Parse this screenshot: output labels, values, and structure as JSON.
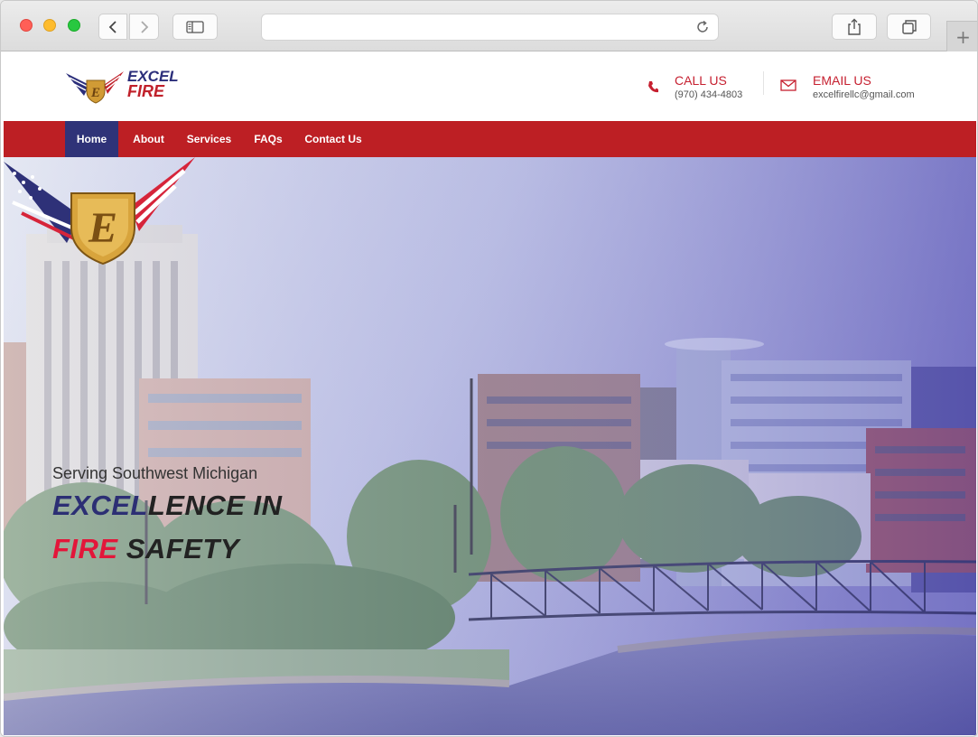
{
  "browser": {
    "back_icon": "chevron-left-icon",
    "forward_icon": "chevron-right-icon",
    "reload_icon": "reload-icon",
    "new_tab_label": "+"
  },
  "site": {
    "logo": {
      "line1": "EXCEL",
      "line2": "FIRE"
    },
    "call": {
      "title": "CALL US",
      "value": "(970) 434-4803"
    },
    "email": {
      "title": "EMAIL US",
      "value": "excelfirellc@gmail.com"
    }
  },
  "nav": {
    "items": [
      {
        "label": "Home",
        "active": true
      },
      {
        "label": "About",
        "active": false
      },
      {
        "label": "Services",
        "active": false
      },
      {
        "label": "FAQs",
        "active": false
      },
      {
        "label": "Contact Us",
        "active": false
      }
    ]
  },
  "hero": {
    "logo_letter": "E",
    "tagline": "Serving Southwest Michigan",
    "headline_line1_part1": "EXCEL",
    "headline_line1_part2": "LENCE IN",
    "headline_line2_part1": "FIRE",
    "headline_line2_part2": " SAFETY"
  },
  "colors": {
    "brand_red": "#bd1f24",
    "brand_navy": "#2f3378",
    "accent_red": "#e3163a"
  }
}
